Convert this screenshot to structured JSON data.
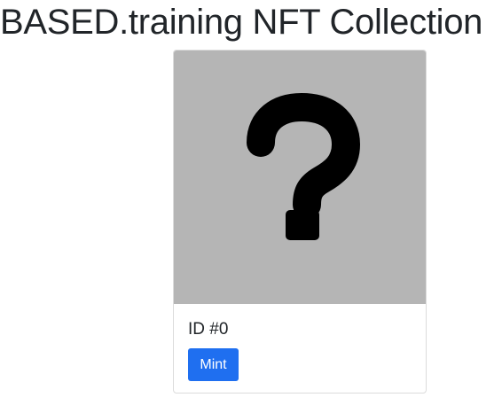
{
  "page": {
    "title": "BASED.training NFT Collection"
  },
  "card": {
    "image_icon": "question-mark-icon",
    "id_label": "ID #0",
    "mint_label": "Mint"
  },
  "colors": {
    "image_background": "#b5b5b5",
    "mint_button": "#1f6ff0"
  }
}
